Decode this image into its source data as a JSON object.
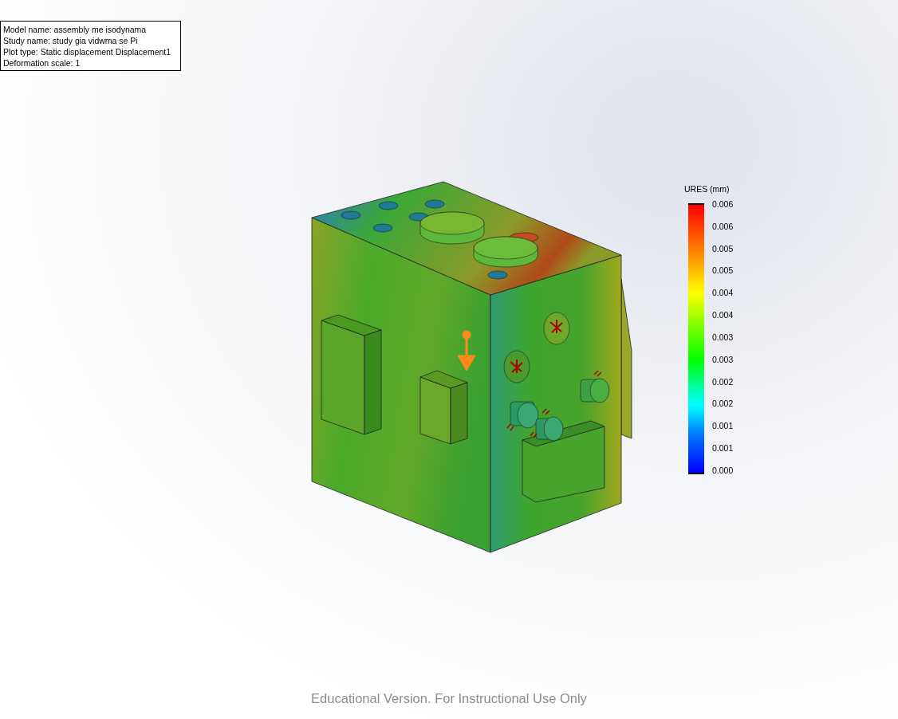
{
  "info_box": {
    "lines": [
      "Model name: assembly me isodynama",
      "Study name: study gia vidwma se Pi",
      "Plot type: Static displacement Displacement1",
      "Deformation scale: 1"
    ]
  },
  "legend": {
    "title": "URES (mm)",
    "ticks": [
      "0.006",
      "0.006",
      "0.005",
      "0.005",
      "0.004",
      "0.004",
      "0.003",
      "0.003",
      "0.002",
      "0.002",
      "0.001",
      "0.001",
      "0.000"
    ]
  },
  "footer": {
    "text": "Educational Version. For Instructional Use Only"
  }
}
